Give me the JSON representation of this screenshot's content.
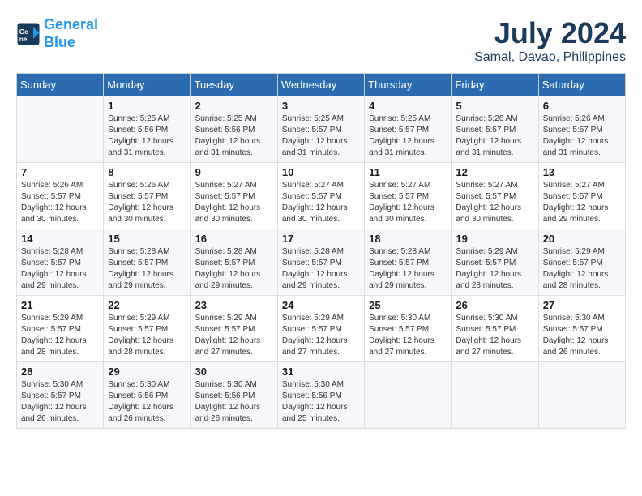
{
  "header": {
    "logo_line1": "General",
    "logo_line2": "Blue",
    "month": "July 2024",
    "location": "Samal, Davao, Philippines"
  },
  "weekdays": [
    "Sunday",
    "Monday",
    "Tuesday",
    "Wednesday",
    "Thursday",
    "Friday",
    "Saturday"
  ],
  "weeks": [
    [
      {
        "day": "",
        "detail": ""
      },
      {
        "day": "1",
        "detail": "Sunrise: 5:25 AM\nSunset: 5:56 PM\nDaylight: 12 hours\nand 31 minutes."
      },
      {
        "day": "2",
        "detail": "Sunrise: 5:25 AM\nSunset: 5:56 PM\nDaylight: 12 hours\nand 31 minutes."
      },
      {
        "day": "3",
        "detail": "Sunrise: 5:25 AM\nSunset: 5:57 PM\nDaylight: 12 hours\nand 31 minutes."
      },
      {
        "day": "4",
        "detail": "Sunrise: 5:25 AM\nSunset: 5:57 PM\nDaylight: 12 hours\nand 31 minutes."
      },
      {
        "day": "5",
        "detail": "Sunrise: 5:26 AM\nSunset: 5:57 PM\nDaylight: 12 hours\nand 31 minutes."
      },
      {
        "day": "6",
        "detail": "Sunrise: 5:26 AM\nSunset: 5:57 PM\nDaylight: 12 hours\nand 31 minutes."
      }
    ],
    [
      {
        "day": "7",
        "detail": "Sunrise: 5:26 AM\nSunset: 5:57 PM\nDaylight: 12 hours\nand 30 minutes."
      },
      {
        "day": "8",
        "detail": "Sunrise: 5:26 AM\nSunset: 5:57 PM\nDaylight: 12 hours\nand 30 minutes."
      },
      {
        "day": "9",
        "detail": "Sunrise: 5:27 AM\nSunset: 5:57 PM\nDaylight: 12 hours\nand 30 minutes."
      },
      {
        "day": "10",
        "detail": "Sunrise: 5:27 AM\nSunset: 5:57 PM\nDaylight: 12 hours\nand 30 minutes."
      },
      {
        "day": "11",
        "detail": "Sunrise: 5:27 AM\nSunset: 5:57 PM\nDaylight: 12 hours\nand 30 minutes."
      },
      {
        "day": "12",
        "detail": "Sunrise: 5:27 AM\nSunset: 5:57 PM\nDaylight: 12 hours\nand 30 minutes."
      },
      {
        "day": "13",
        "detail": "Sunrise: 5:27 AM\nSunset: 5:57 PM\nDaylight: 12 hours\nand 29 minutes."
      }
    ],
    [
      {
        "day": "14",
        "detail": "Sunrise: 5:28 AM\nSunset: 5:57 PM\nDaylight: 12 hours\nand 29 minutes."
      },
      {
        "day": "15",
        "detail": "Sunrise: 5:28 AM\nSunset: 5:57 PM\nDaylight: 12 hours\nand 29 minutes."
      },
      {
        "day": "16",
        "detail": "Sunrise: 5:28 AM\nSunset: 5:57 PM\nDaylight: 12 hours\nand 29 minutes."
      },
      {
        "day": "17",
        "detail": "Sunrise: 5:28 AM\nSunset: 5:57 PM\nDaylight: 12 hours\nand 29 minutes."
      },
      {
        "day": "18",
        "detail": "Sunrise: 5:28 AM\nSunset: 5:57 PM\nDaylight: 12 hours\nand 29 minutes."
      },
      {
        "day": "19",
        "detail": "Sunrise: 5:29 AM\nSunset: 5:57 PM\nDaylight: 12 hours\nand 28 minutes."
      },
      {
        "day": "20",
        "detail": "Sunrise: 5:29 AM\nSunset: 5:57 PM\nDaylight: 12 hours\nand 28 minutes."
      }
    ],
    [
      {
        "day": "21",
        "detail": "Sunrise: 5:29 AM\nSunset: 5:57 PM\nDaylight: 12 hours\nand 28 minutes."
      },
      {
        "day": "22",
        "detail": "Sunrise: 5:29 AM\nSunset: 5:57 PM\nDaylight: 12 hours\nand 28 minutes."
      },
      {
        "day": "23",
        "detail": "Sunrise: 5:29 AM\nSunset: 5:57 PM\nDaylight: 12 hours\nand 27 minutes."
      },
      {
        "day": "24",
        "detail": "Sunrise: 5:29 AM\nSunset: 5:57 PM\nDaylight: 12 hours\nand 27 minutes."
      },
      {
        "day": "25",
        "detail": "Sunrise: 5:30 AM\nSunset: 5:57 PM\nDaylight: 12 hours\nand 27 minutes."
      },
      {
        "day": "26",
        "detail": "Sunrise: 5:30 AM\nSunset: 5:57 PM\nDaylight: 12 hours\nand 27 minutes."
      },
      {
        "day": "27",
        "detail": "Sunrise: 5:30 AM\nSunset: 5:57 PM\nDaylight: 12 hours\nand 26 minutes."
      }
    ],
    [
      {
        "day": "28",
        "detail": "Sunrise: 5:30 AM\nSunset: 5:57 PM\nDaylight: 12 hours\nand 26 minutes."
      },
      {
        "day": "29",
        "detail": "Sunrise: 5:30 AM\nSunset: 5:56 PM\nDaylight: 12 hours\nand 26 minutes."
      },
      {
        "day": "30",
        "detail": "Sunrise: 5:30 AM\nSunset: 5:56 PM\nDaylight: 12 hours\nand 26 minutes."
      },
      {
        "day": "31",
        "detail": "Sunrise: 5:30 AM\nSunset: 5:56 PM\nDaylight: 12 hours\nand 25 minutes."
      },
      {
        "day": "",
        "detail": ""
      },
      {
        "day": "",
        "detail": ""
      },
      {
        "day": "",
        "detail": ""
      }
    ]
  ]
}
